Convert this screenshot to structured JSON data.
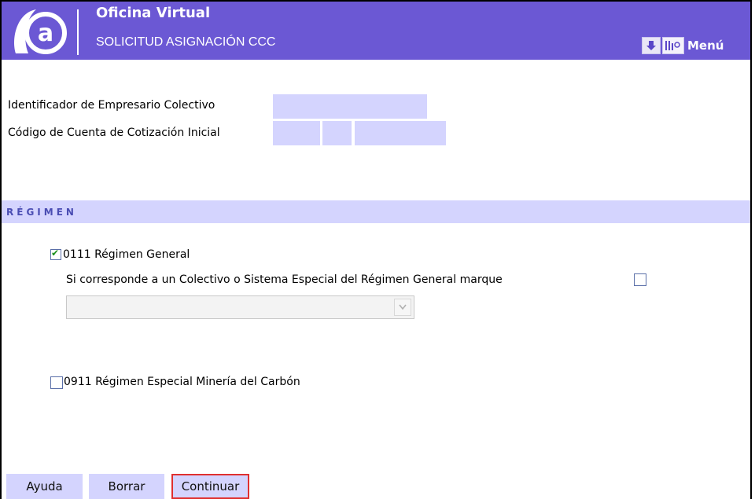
{
  "header": {
    "logo_alt": "@",
    "title": "Oficina Virtual",
    "subtitle": "SOLICITUD ASIGNACIÓN CCC",
    "menu_label": "Menú"
  },
  "form": {
    "empresario_label": "Identificador de Empresario Colectivo",
    "codigo_label": "Código de Cuenta de Cotización Inicial"
  },
  "section": {
    "title": "RÉGIMEN"
  },
  "regimen": {
    "general_label": "0111 Régimen General",
    "general_checked": true,
    "colectivo_label": "Si corresponde a un Colectivo o Sistema Especial del Régimen General marque",
    "colectivo_checked": false,
    "select_value": "",
    "mineria_label": "0911 Régimen Especial Minería del Carbón",
    "mineria_checked": false
  },
  "buttons": {
    "ayuda": "Ayuda",
    "borrar": "Borrar",
    "continuar": "Continuar"
  },
  "colors": {
    "header_bg": "#6b58d4",
    "field_bg": "#d4d4fe",
    "focus_border": "#e03030"
  }
}
